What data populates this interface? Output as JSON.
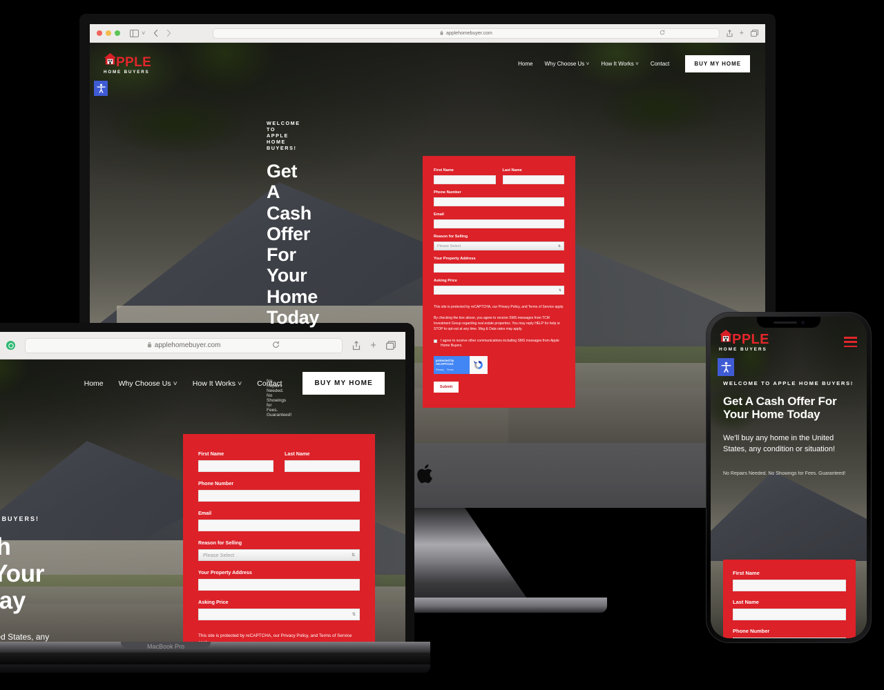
{
  "brand": {
    "name_word": "PPLE",
    "tagline": "HOME BUYERS",
    "accent_red": "#dc2128",
    "logo_icon": "house-logo-icon"
  },
  "browser": {
    "url": "applehomebuyer.com",
    "lock_icon": "lock-icon",
    "reload_icon": "reload-icon",
    "share_icon": "share-icon",
    "newtab_icon": "plus-icon",
    "tabs_icon": "tabs-icon",
    "sidebar_icon": "sidebar-icon",
    "back_icon": "chevron-left-icon",
    "forward_icon": "chevron-right-icon",
    "extension_icon": "extension-icon"
  },
  "nav": {
    "items": [
      {
        "label": "Home",
        "has_dropdown": false
      },
      {
        "label": "Why Choose Us",
        "has_dropdown": true
      },
      {
        "label": "How It Works",
        "has_dropdown": true
      },
      {
        "label": "Contact",
        "has_dropdown": false
      }
    ],
    "cta_label": "BUY MY HOME",
    "mobile_menu_icon": "hamburger-menu-icon"
  },
  "accessibility_widget": {
    "icon": "accessibility-icon",
    "background": "#3f5bd4"
  },
  "hero": {
    "eyebrow": "WELCOME TO APPLE HOME BUYERS!",
    "heading_lines_desktop": [
      "Get A Cash",
      "Offer For Your",
      "Home Today"
    ],
    "heading_lines_mobile": [
      "Get A Cash Offer For",
      "Your Home Today"
    ],
    "subtext": "We'll buy any home in the United States, any condition or situation!",
    "subtext_mobile": "We'll buy any home in the United States, any condition or situation!",
    "guarantee": "No Repairs Needed. No Showings for Fees. Guaranteed!"
  },
  "form": {
    "fields": [
      {
        "label": "First Name",
        "type": "text",
        "value": "",
        "name": "first-name"
      },
      {
        "label": "Last Name",
        "type": "text",
        "value": "",
        "name": "last-name"
      },
      {
        "label": "Phone Number",
        "type": "text",
        "value": "",
        "name": "phone-number"
      },
      {
        "label": "Email",
        "type": "text",
        "value": "",
        "name": "email"
      },
      {
        "label": "Reason for Selling",
        "type": "select",
        "value": "",
        "placeholder": "Please Select",
        "name": "reason-for-selling"
      },
      {
        "label": "Your Property Address",
        "type": "text",
        "value": "",
        "name": "property-address"
      },
      {
        "label": "Asking Price",
        "type": "number",
        "value": "",
        "name": "asking-price"
      }
    ],
    "recaptcha_notice": "This site is protected by reCAPTCHA, our Privacy Policy, and Terms of Service apply.",
    "sms_notice": "By checking the box above, you agree to receive SMS messages from TCM Investment Group regarding real estate properties. You may reply HELP for help or STOP to opt-out at any time. Msg & Data rates may apply.",
    "consent_label": "I agree to receive other communications including SMS messages from Apple Home Buyers.",
    "consent_checked": false,
    "recaptcha_badge": {
      "title": "protected by reCAPTCHA",
      "privacy": "Privacy",
      "terms": "Terms",
      "icon": "recaptcha-icon"
    },
    "submit_label": "Submit"
  },
  "devices": {
    "imac": {
      "label": "",
      "logo_icon": "apple-logo-icon"
    },
    "macbook": {
      "label": "MacBook Pro"
    },
    "iphone": {
      "label": ""
    }
  }
}
